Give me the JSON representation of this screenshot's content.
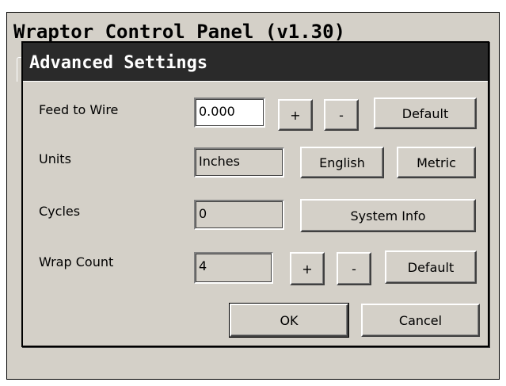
{
  "parent_window": {
    "title": "Wraptor Control Panel (v1.30)"
  },
  "dialog": {
    "title": "Advanced Settings",
    "rows": {
      "feed_to_wire": {
        "label": "Feed to Wire",
        "value": "0.000",
        "plus_label": "+",
        "minus_label": "-",
        "default_label": "Default"
      },
      "units": {
        "label": "Units",
        "value": "Inches",
        "english_label": "English",
        "metric_label": "Metric"
      },
      "cycles": {
        "label": "Cycles",
        "value": "0",
        "system_info_label": "System Info"
      },
      "wrap_count": {
        "label": "Wrap Count",
        "value": "4",
        "plus_label": "+",
        "minus_label": "-",
        "default_label": "Default"
      }
    },
    "ok_label": "OK",
    "cancel_label": "Cancel"
  },
  "colors": {
    "face": "#d4d0c8",
    "title_bar": "#2a2a2a",
    "title_text": "#ffffff",
    "field_bg": "#ffffff"
  }
}
